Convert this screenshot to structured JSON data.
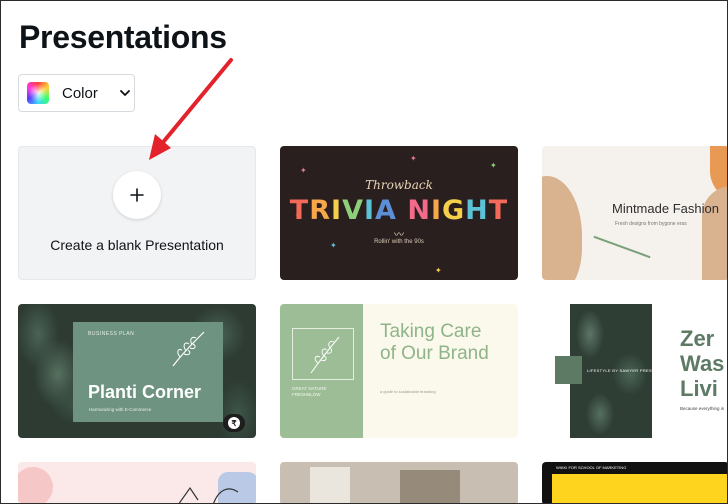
{
  "page": {
    "title": "Presentations"
  },
  "filters": {
    "color_label": "Color"
  },
  "blank_card": {
    "label": "Create a blank Presentation"
  },
  "templates": {
    "trivia": {
      "subtitle": "Throwback",
      "title_words": [
        "T",
        "R",
        "I",
        "V",
        "I",
        "A",
        " ",
        "N",
        "I",
        "G",
        "H",
        "T"
      ],
      "tagline": "Rollin' with the 90s"
    },
    "mintmade": {
      "title": "Mintmade Fashion",
      "tagline": "Fresh designs from bygone eras"
    },
    "planti": {
      "kicker": "BUSINESS PLAN",
      "title": "Planti Corner",
      "tagline": "Harmonizing with E-Commerce",
      "badge": "₹"
    },
    "taking_care": {
      "title_line1": "Taking Care",
      "title_line2": "of Our Brand",
      "side_text": "GREAT NATURE FRESHBLOW",
      "tagline": "a guide to sustainable branding"
    },
    "zero_waste": {
      "kicker": "LIFESTYLE BY SAWYER PRESENTS",
      "line1": "Zer",
      "line2": "Was",
      "line3": "Livi",
      "tagline": "Because everything is"
    },
    "yellow": {
      "tagline": "WIKKI FOR SCHOOL OF MARKETING"
    }
  },
  "colors": {
    "trivia_palette": [
      "#f36a5a",
      "#f7a64a",
      "#f5d04a",
      "#8fcf7a",
      "#5cc2d6",
      "#5c8fd6",
      "#c77ad6",
      "#f36a8a",
      "#f7a64a",
      "#f5d04a",
      "#5cc2d6",
      "#f36a5a"
    ],
    "arrow": "#e3222b"
  }
}
